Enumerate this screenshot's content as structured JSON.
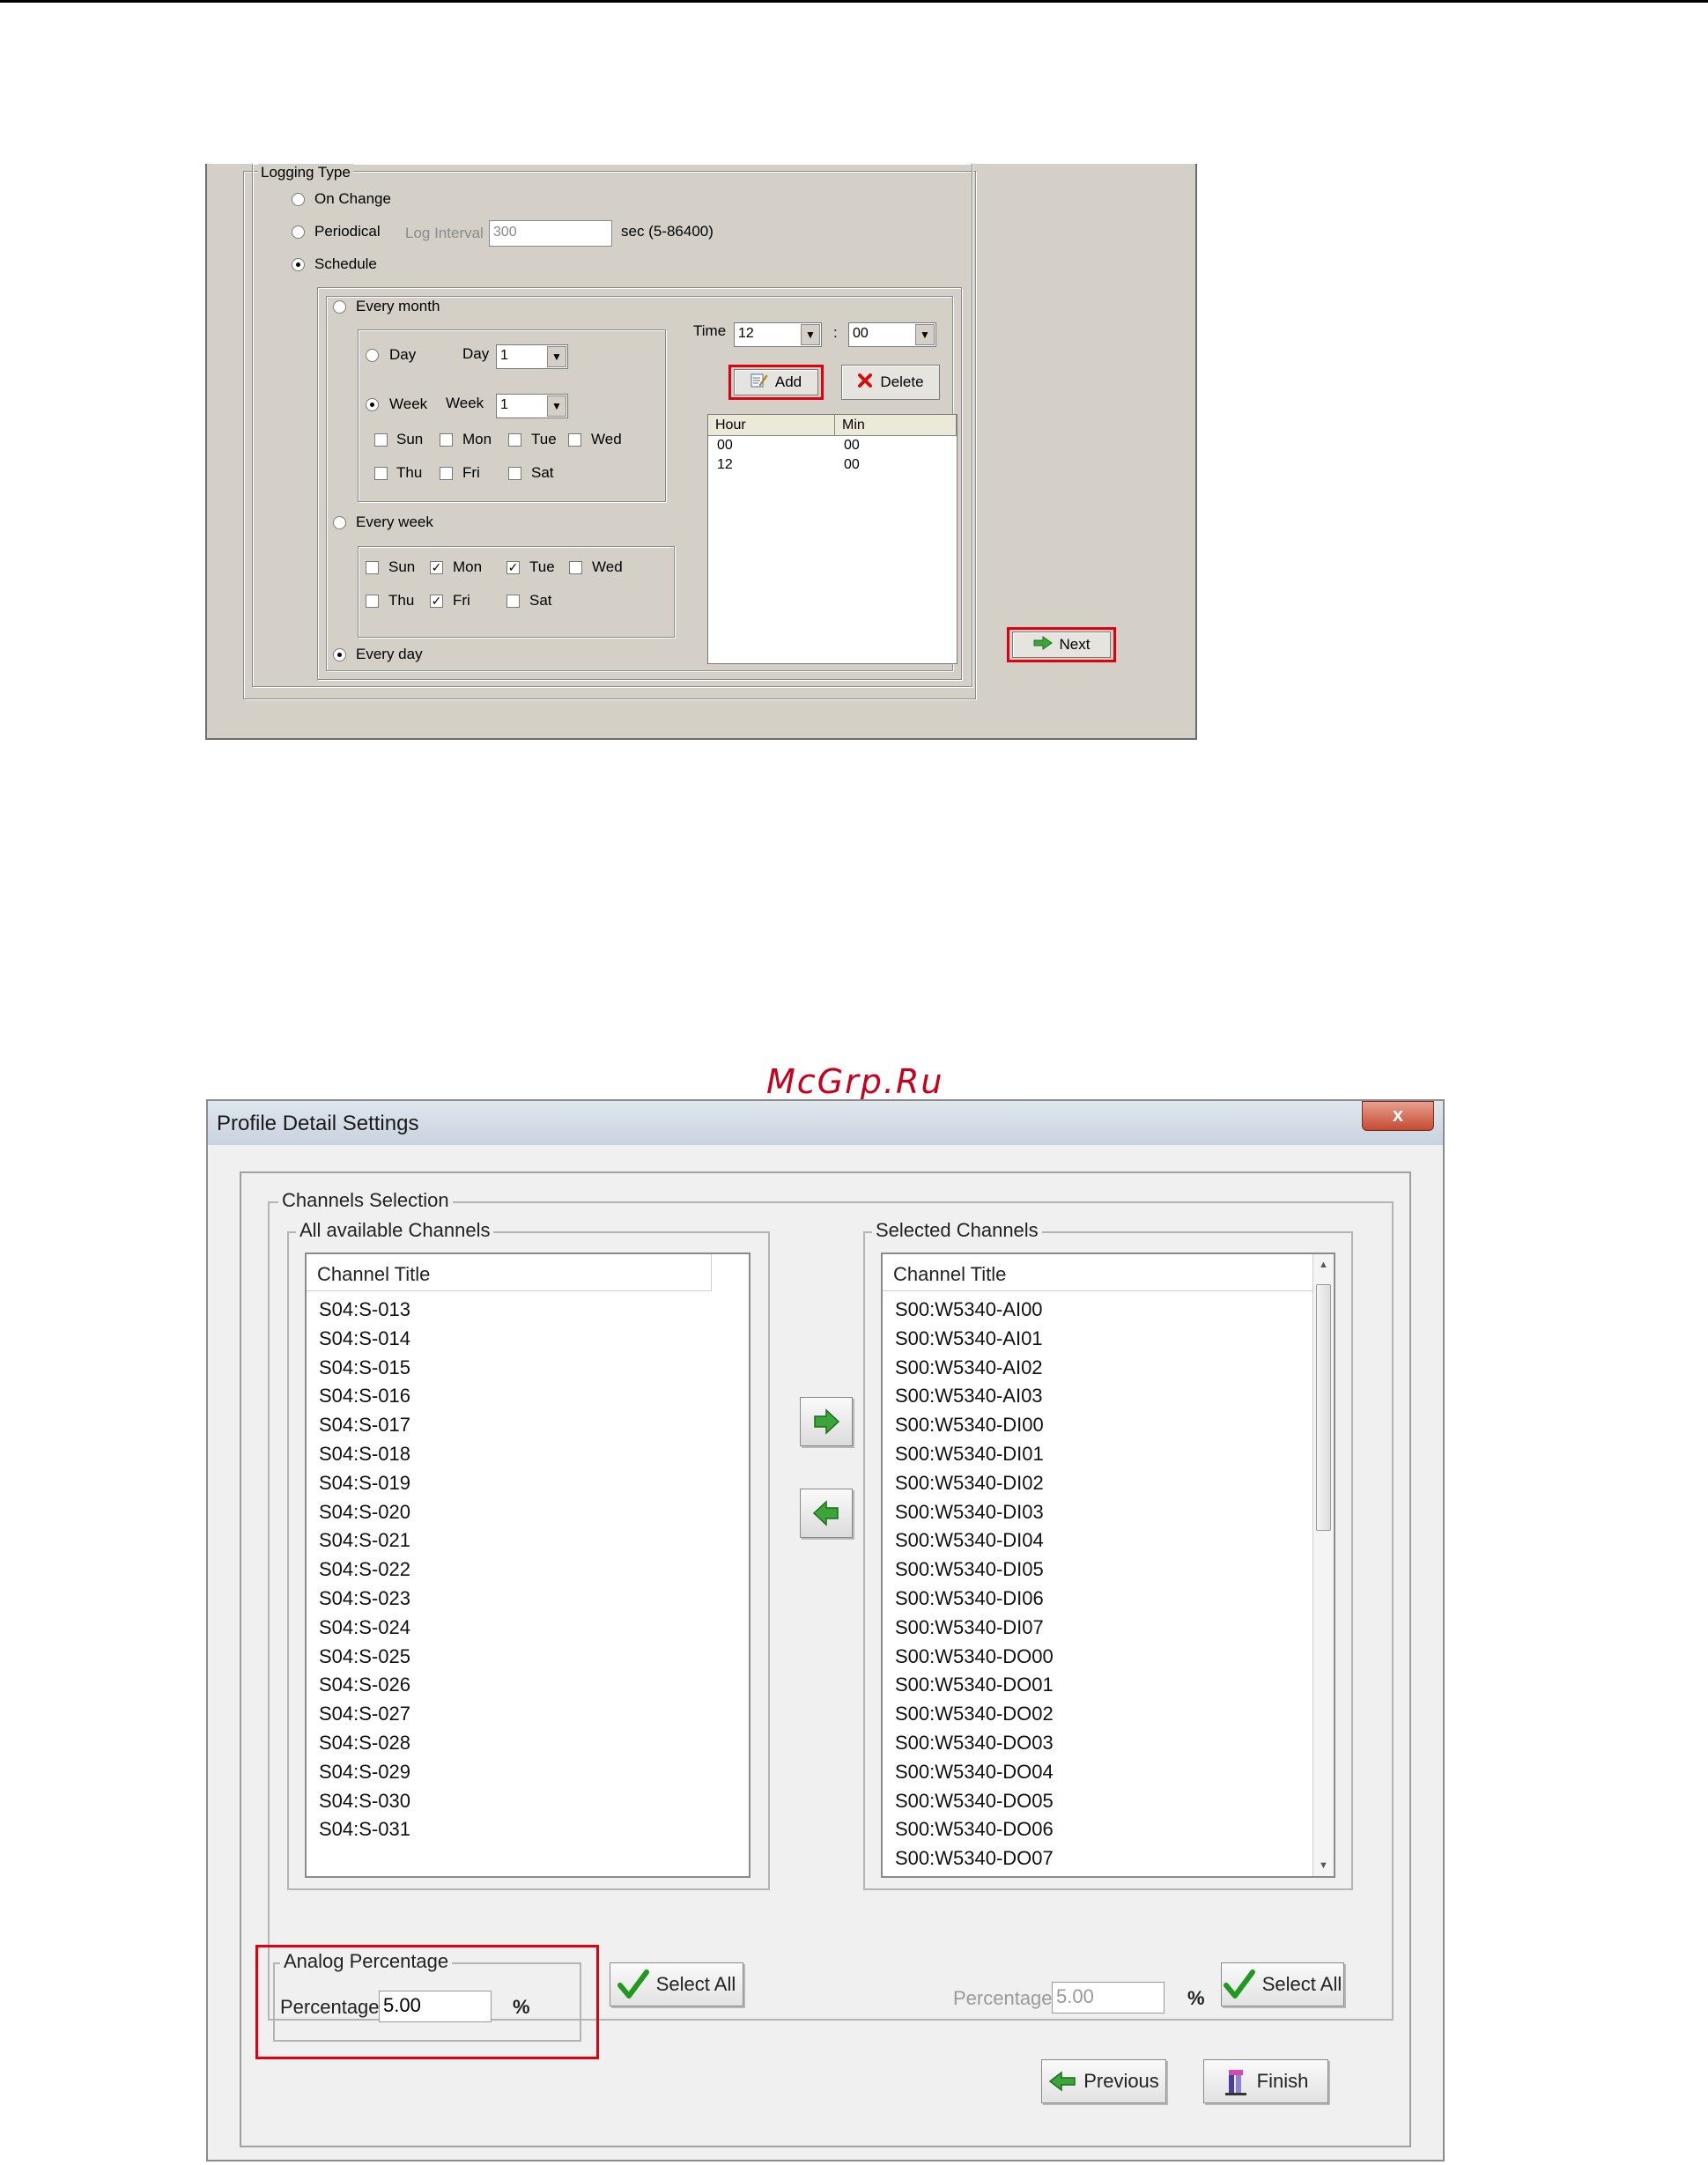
{
  "logging": {
    "group_label": "Logging Type",
    "on_change": "On Change",
    "periodical": "Periodical",
    "log_interval_label": "Log Interval",
    "log_interval_value": "300",
    "sec_range": "sec (5-86400)",
    "schedule": "Schedule",
    "every_month": "Every month",
    "day_option": "Day",
    "day_label": "Day",
    "day_value": "1",
    "week_option": "Week",
    "week_label": "Week",
    "week_value": "1",
    "month_days": [
      "Sun",
      "Mon",
      "Tue",
      "Wed",
      "Thu",
      "Fri",
      "Sat"
    ],
    "every_week": "Every week",
    "week_days": [
      "Sun",
      "Mon",
      "Tue",
      "Wed",
      "Thu",
      "Fri",
      "Sat"
    ],
    "week_days_checked": [
      false,
      true,
      true,
      false,
      false,
      true,
      false
    ],
    "every_day": "Every day",
    "time_label": "Time",
    "time_hour": "12",
    "time_sep": ":",
    "time_min": "00",
    "add_label": "Add",
    "delete_label": "Delete",
    "list_headers": [
      "Hour",
      "Min"
    ],
    "list_rows": [
      [
        "00",
        "00"
      ],
      [
        "12",
        "00"
      ]
    ],
    "next_label": "Next"
  },
  "watermark": "McGrp.Ru",
  "profile": {
    "window_title": "Profile Detail Settings",
    "close_glyph": "x",
    "channels_selection": "Channels Selection",
    "all_channels": "All available Channels",
    "selected_channels": "Selected Channels",
    "column_title": "Channel Title",
    "available": [
      "S04:S-013",
      "S04:S-014",
      "S04:S-015",
      "S04:S-016",
      "S04:S-017",
      "S04:S-018",
      "S04:S-019",
      "S04:S-020",
      "S04:S-021",
      "S04:S-022",
      "S04:S-023",
      "S04:S-024",
      "S04:S-025",
      "S04:S-026",
      "S04:S-027",
      "S04:S-028",
      "S04:S-029",
      "S04:S-030",
      "S04:S-031"
    ],
    "selected": [
      "S00:W5340-AI00",
      "S00:W5340-AI01",
      "S00:W5340-AI02",
      "S00:W5340-AI03",
      "S00:W5340-DI00",
      "S00:W5340-DI01",
      "S00:W5340-DI02",
      "S00:W5340-DI03",
      "S00:W5340-DI04",
      "S00:W5340-DI05",
      "S00:W5340-DI06",
      "S00:W5340-DI07",
      "S00:W5340-DO00",
      "S00:W5340-DO01",
      "S00:W5340-DO02",
      "S00:W5340-DO03",
      "S00:W5340-DO04",
      "S00:W5340-DO05",
      "S00:W5340-DO06",
      "S00:W5340-DO07"
    ],
    "analog_group": "Analog Percentage",
    "percentage_label": "Percentage",
    "percentage_value": "5.00",
    "percent_sign": "%",
    "right_percentage_label": "Percentage",
    "right_percentage_value": "5.00",
    "right_percent_sign": "%",
    "select_all": "Select All",
    "select_all_right": "Select All",
    "previous": "Previous",
    "finish": "Finish"
  },
  "colors": {
    "highlight": "#e00010",
    "arrow_green": "#3aa63a",
    "watermark": "#c8001e"
  }
}
